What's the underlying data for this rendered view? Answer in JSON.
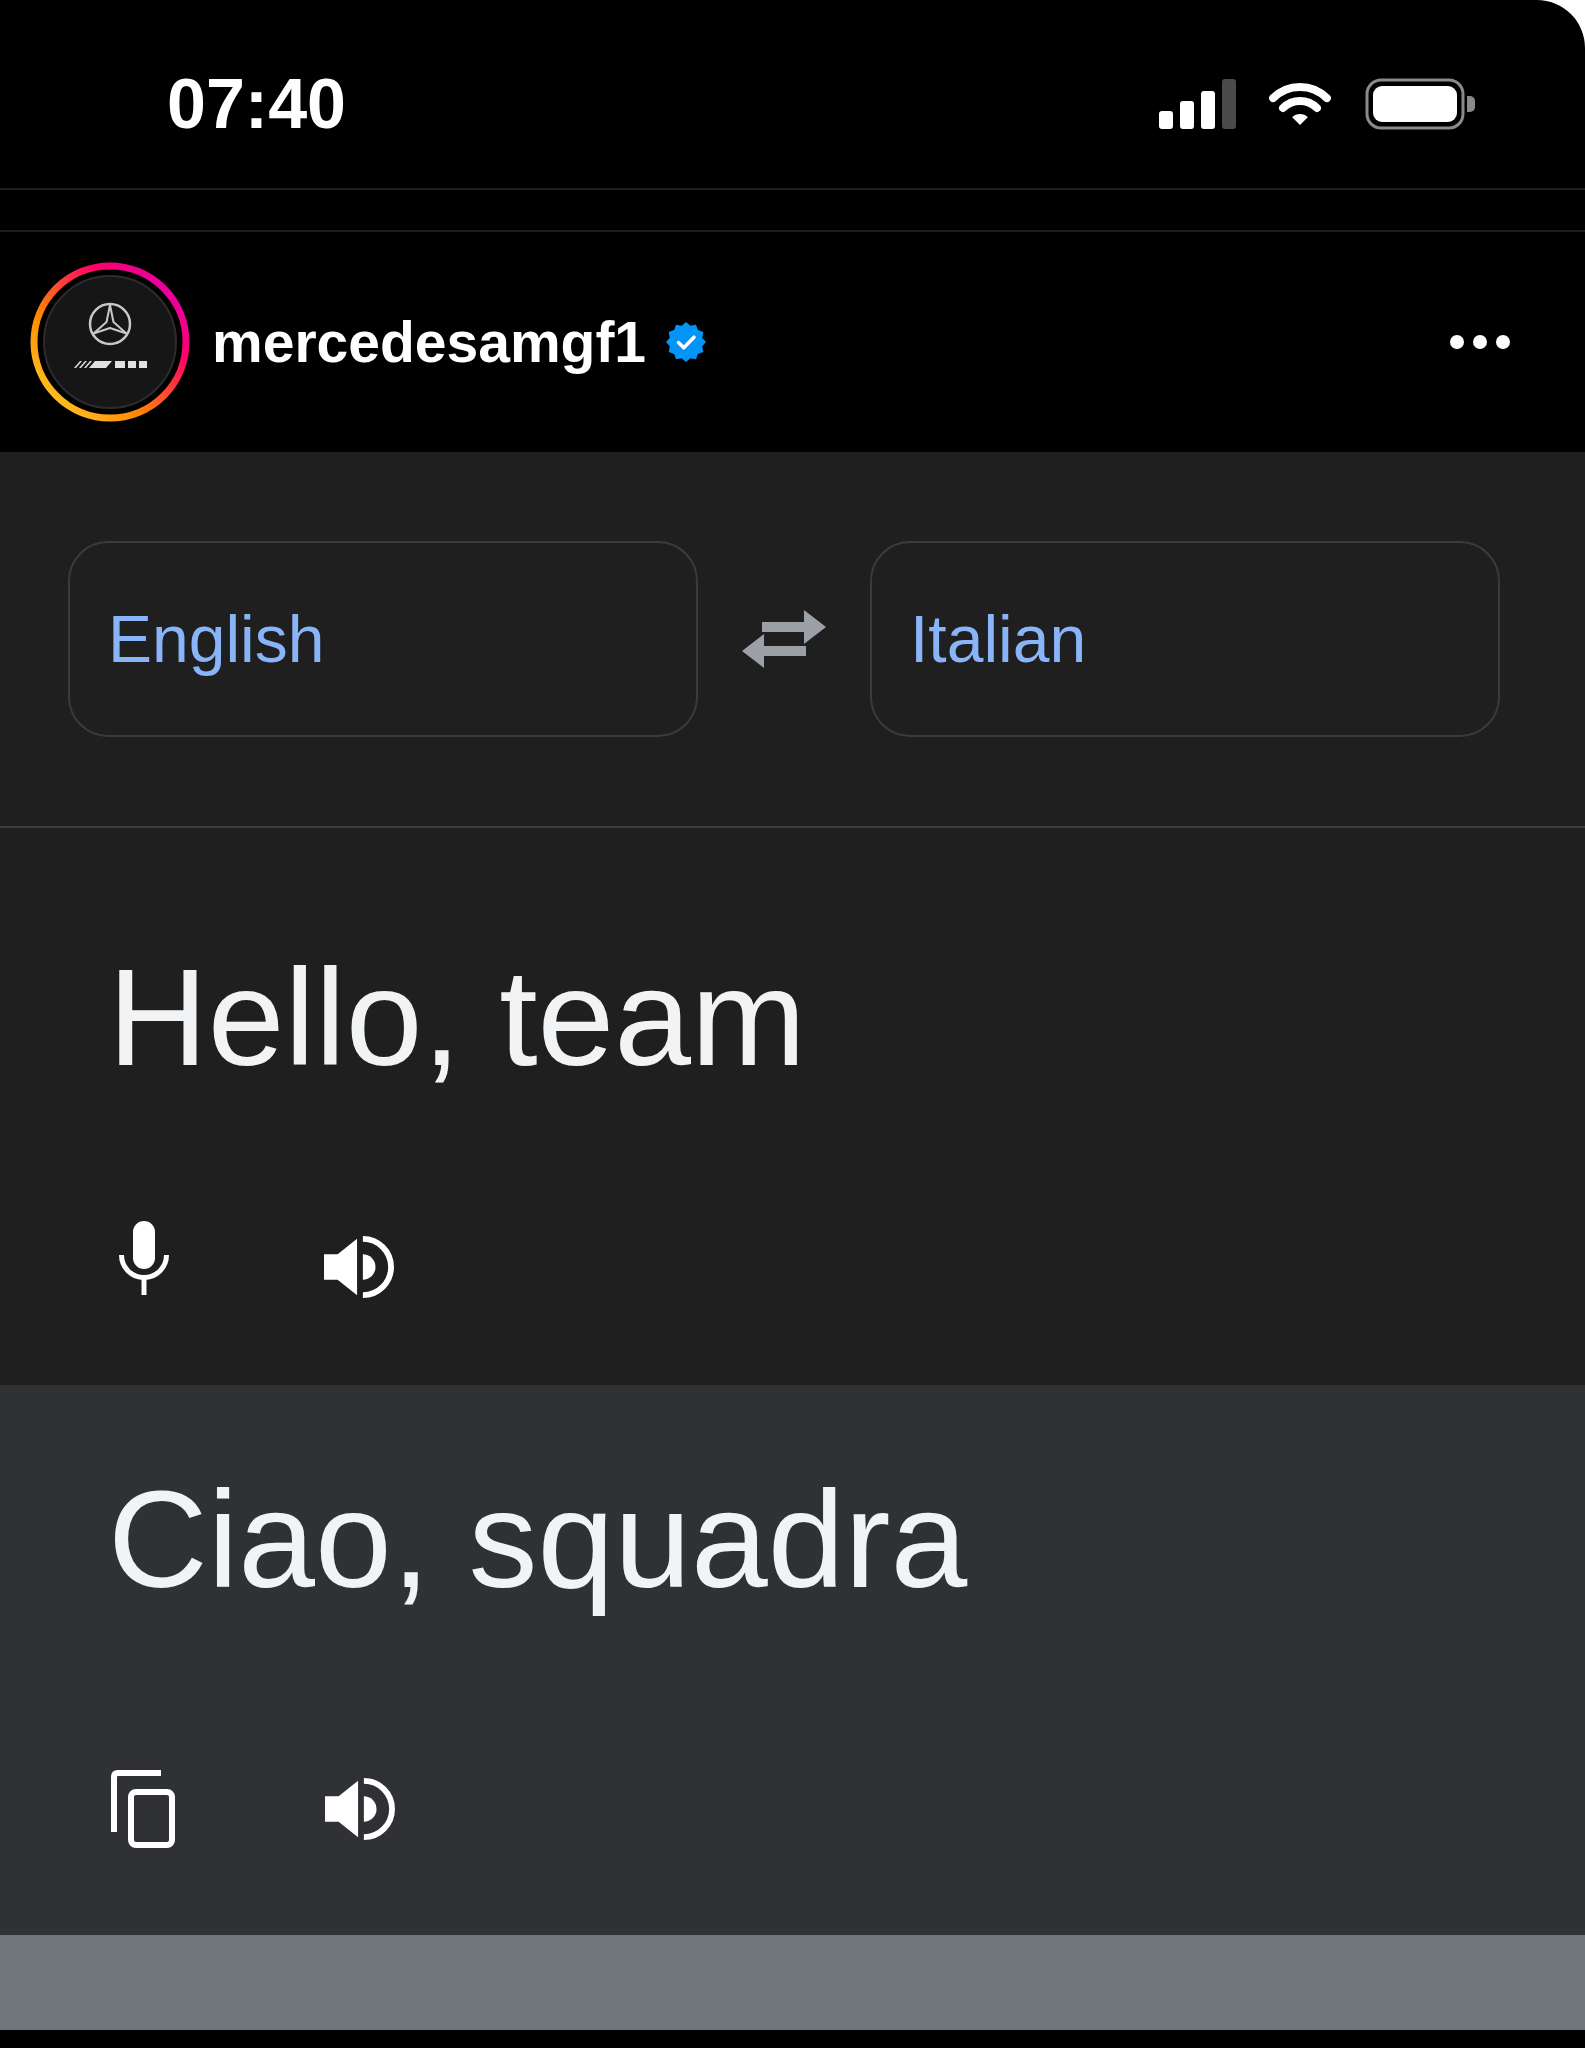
{
  "status_bar": {
    "time": "07:40"
  },
  "post_header": {
    "username": "mercedesamgf1",
    "verified": true
  },
  "language_picker": {
    "source_language": "English",
    "target_language": "Italian"
  },
  "source_panel": {
    "text": "Hello, team"
  },
  "translation_panel": {
    "text": "Ciao, squadra"
  }
}
